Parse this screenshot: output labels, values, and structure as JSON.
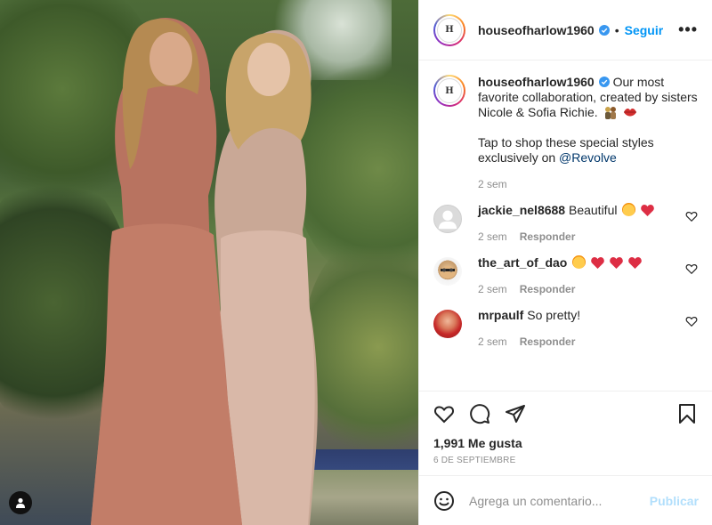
{
  "photo": {
    "alt_icon": "user-tag-icon"
  },
  "header": {
    "username": "houseofharlow1960",
    "avatar_text": "H",
    "separator": "•",
    "follow_label": "Seguir",
    "more_label": "•••"
  },
  "caption": {
    "username": "houseofharlow1960",
    "line1": "Our most favorite collaboration, created by sisters Nicole & Sofia Richie.",
    "line2": "Tap to shop these special styles exclusively on",
    "mention": "@Revolve",
    "time": "2 sem"
  },
  "comments": [
    {
      "username": "jackie_nel8688",
      "text": "Beautiful",
      "time": "2 sem",
      "reply_label": "Responder"
    },
    {
      "username": "the_art_of_dao",
      "text": "",
      "time": "2 sem",
      "reply_label": "Responder"
    },
    {
      "username": "mrpaulf",
      "text": "So pretty!",
      "time": "2 sem",
      "reply_label": "Responder"
    }
  ],
  "likes": "1,991 Me gusta",
  "date": "6 DE SEPTIEMBRE",
  "add_comment": {
    "placeholder": "Agrega un comentario...",
    "publish_label": "Publicar"
  },
  "colors": {
    "accent": "#0095f6",
    "verified": "#3897f0",
    "muted": "#8e8e8e",
    "publish_disabled": "#b2dffc"
  }
}
